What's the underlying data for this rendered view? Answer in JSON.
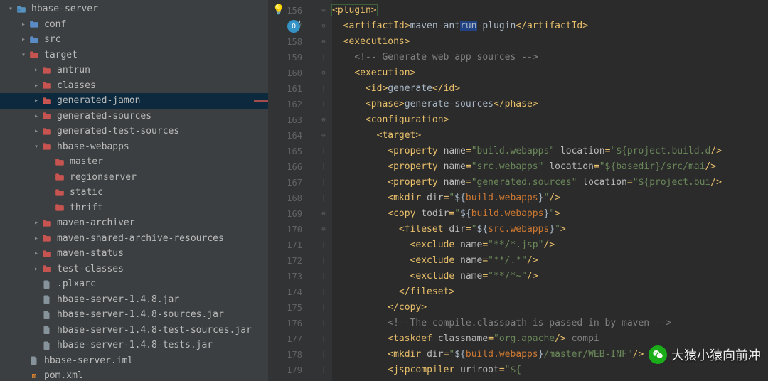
{
  "tree": [
    {
      "indent": 0,
      "arrow": "▾",
      "icon": "module",
      "label": "hbase-server",
      "selected": false
    },
    {
      "indent": 1,
      "arrow": "▸",
      "icon": "folder-blue",
      "label": "conf"
    },
    {
      "indent": 1,
      "arrow": "▸",
      "icon": "folder-blue",
      "label": "src"
    },
    {
      "indent": 1,
      "arrow": "▾",
      "icon": "folder-red",
      "label": "target"
    },
    {
      "indent": 2,
      "arrow": "▸",
      "icon": "folder-red",
      "label": "antrun"
    },
    {
      "indent": 2,
      "arrow": "▸",
      "icon": "folder-red",
      "label": "classes"
    },
    {
      "indent": 2,
      "arrow": "▸",
      "icon": "folder-red",
      "label": "generated-jamon",
      "selected": true,
      "redmark": true
    },
    {
      "indent": 2,
      "arrow": "▸",
      "icon": "folder-red",
      "label": "generated-sources"
    },
    {
      "indent": 2,
      "arrow": "▸",
      "icon": "folder-red",
      "label": "generated-test-sources"
    },
    {
      "indent": 2,
      "arrow": "▾",
      "icon": "folder-red",
      "label": "hbase-webapps"
    },
    {
      "indent": 3,
      "arrow": "",
      "icon": "folder-red",
      "label": "master"
    },
    {
      "indent": 3,
      "arrow": "",
      "icon": "folder-red",
      "label": "regionserver"
    },
    {
      "indent": 3,
      "arrow": "",
      "icon": "folder-red",
      "label": "static"
    },
    {
      "indent": 3,
      "arrow": "",
      "icon": "folder-red",
      "label": "thrift"
    },
    {
      "indent": 2,
      "arrow": "▸",
      "icon": "folder-red",
      "label": "maven-archiver"
    },
    {
      "indent": 2,
      "arrow": "▸",
      "icon": "folder-red",
      "label": "maven-shared-archive-resources"
    },
    {
      "indent": 2,
      "arrow": "▸",
      "icon": "folder-red",
      "label": "maven-status"
    },
    {
      "indent": 2,
      "arrow": "▸",
      "icon": "folder-red",
      "label": "test-classes"
    },
    {
      "indent": 2,
      "arrow": "",
      "icon": "file-gray",
      "label": ".plxarc"
    },
    {
      "indent": 2,
      "arrow": "",
      "icon": "file-gray",
      "label": "hbase-server-1.4.8.jar"
    },
    {
      "indent": 2,
      "arrow": "",
      "icon": "file-gray",
      "label": "hbase-server-1.4.8-sources.jar"
    },
    {
      "indent": 2,
      "arrow": "",
      "icon": "file-gray",
      "label": "hbase-server-1.4.8-test-sources.jar"
    },
    {
      "indent": 2,
      "arrow": "",
      "icon": "file-gray",
      "label": "hbase-server-1.4.8-tests.jar"
    },
    {
      "indent": 1,
      "arrow": "",
      "icon": "file-gray",
      "label": "hbase-server.iml"
    },
    {
      "indent": 1,
      "arrow": "",
      "icon": "file-m",
      "label": "pom.xml"
    }
  ],
  "lineStart": 156,
  "lineCount": 24,
  "code": [
    {
      "ind": 0,
      "type": "open",
      "tag": "plugin",
      "boxed": true
    },
    {
      "ind": 1,
      "type": "wrap",
      "tag": "artifactId",
      "text": "maven-antrun-plugin",
      "selrange": [
        9,
        12
      ]
    },
    {
      "ind": 1,
      "type": "open",
      "tag": "executions"
    },
    {
      "ind": 2,
      "type": "comment",
      "text": "<!-- Generate web app sources -->"
    },
    {
      "ind": 2,
      "type": "open",
      "tag": "execution"
    },
    {
      "ind": 3,
      "type": "wrap",
      "tag": "id",
      "text": "generate"
    },
    {
      "ind": 3,
      "type": "wrap",
      "tag": "phase",
      "text": "generate-sources"
    },
    {
      "ind": 3,
      "type": "open",
      "tag": "configuration"
    },
    {
      "ind": 4,
      "type": "open",
      "tag": "target"
    },
    {
      "ind": 5,
      "type": "selfattr",
      "tag": "property",
      "attrs": [
        [
          "name",
          "build.webapps"
        ],
        [
          "location",
          "${project.build.d",
          "raw"
        ]
      ]
    },
    {
      "ind": 5,
      "type": "selfattr",
      "tag": "property",
      "attrs": [
        [
          "name",
          "src.webapps"
        ],
        [
          "location",
          "${basedir}/src/mai",
          "raw"
        ]
      ]
    },
    {
      "ind": 5,
      "type": "selfattr",
      "tag": "property",
      "attrs": [
        [
          "name",
          "generated.sources"
        ],
        [
          "location",
          "${project.bui",
          "raw"
        ]
      ]
    },
    {
      "ind": 5,
      "type": "selfattr",
      "tag": "mkdir",
      "attrs": [
        [
          "dir",
          "${build.webapps}",
          "expr"
        ]
      ]
    },
    {
      "ind": 5,
      "type": "openattr",
      "tag": "copy",
      "attrs": [
        [
          "todir",
          "${build.webapps}",
          "expr"
        ]
      ]
    },
    {
      "ind": 6,
      "type": "openattr",
      "tag": "fileset",
      "attrs": [
        [
          "dir",
          "${src.webapps}",
          "expr"
        ]
      ]
    },
    {
      "ind": 7,
      "type": "selfattr",
      "tag": "exclude",
      "attrs": [
        [
          "name",
          "**/*.jsp"
        ]
      ]
    },
    {
      "ind": 7,
      "type": "selfattr",
      "tag": "exclude",
      "attrs": [
        [
          "name",
          "**/.*"
        ]
      ]
    },
    {
      "ind": 7,
      "type": "selfattr",
      "tag": "exclude",
      "attrs": [
        [
          "name",
          "**/*~"
        ]
      ]
    },
    {
      "ind": 6,
      "type": "close",
      "tag": "fileset"
    },
    {
      "ind": 5,
      "type": "close",
      "tag": "copy"
    },
    {
      "ind": 5,
      "type": "comment",
      "text": "<!--The compile.classpath is passed in by maven -->"
    },
    {
      "ind": 5,
      "type": "selfattr",
      "tag": "taskdef",
      "attrs": [
        [
          "classname",
          "org.apache",
          "raw"
        ]
      ],
      "trailcmt": "compi"
    },
    {
      "ind": 5,
      "type": "selfattr",
      "tag": "mkdir",
      "attrs": [
        [
          "dir",
          "${build.webapps}/master/WEB-INF",
          "exprpath"
        ]
      ]
    },
    {
      "ind": 5,
      "type": "raw",
      "segments": [
        [
          "tag",
          "<jspcompiler "
        ],
        [
          "attr",
          "uriroot"
        ],
        [
          "tag",
          "="
        ],
        [
          "str",
          "\"${"
        ]
      ]
    }
  ],
  "watermark": "大猿小猿向前冲"
}
